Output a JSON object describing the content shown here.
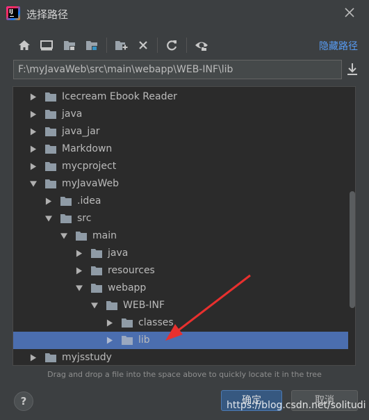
{
  "window": {
    "title": "选择路径",
    "close_glyph": "✕",
    "app_logo_text": "IJ"
  },
  "toolbar": {
    "icons": [
      "home-icon",
      "desktop-icon",
      "project-folder-icon",
      "module-folder-icon",
      "new-folder-icon",
      "delete-icon",
      "refresh-icon",
      "show-hidden-icon"
    ],
    "hide_path_label": "隐藏路径"
  },
  "path_field": {
    "value": "F:\\myJavaWeb\\src\\main\\webapp\\WEB-INF\\lib"
  },
  "tree": {
    "rows": [
      {
        "label": "Icecream Ebook Reader",
        "expanded": false
      },
      {
        "label": "java",
        "expanded": false
      },
      {
        "label": "java_jar",
        "expanded": false
      },
      {
        "label": "Markdown",
        "expanded": false
      },
      {
        "label": "mycproject",
        "expanded": false
      },
      {
        "label": "myJavaWeb",
        "expanded": true
      },
      {
        "label": ".idea",
        "expanded": false
      },
      {
        "label": "src",
        "expanded": true
      },
      {
        "label": "main",
        "expanded": true
      },
      {
        "label": "java",
        "expanded": false
      },
      {
        "label": "resources",
        "expanded": false
      },
      {
        "label": "webapp",
        "expanded": true
      },
      {
        "label": "WEB-INF",
        "expanded": true
      },
      {
        "label": "classes",
        "expanded": false
      },
      {
        "label": "lib",
        "expanded": false,
        "selected": true
      },
      {
        "label": "myjsstudy",
        "expanded": false
      }
    ]
  },
  "hint": "Drag and drop a file into the space above to quickly locate it in the tree",
  "buttons": {
    "help": "?",
    "ok": "确定",
    "cancel": "取消"
  },
  "watermark": "https://blog.csdn.net/solitudi",
  "colors": {
    "background": "#3c3f41",
    "tree_background": "#2b2b2b",
    "selection": "#4b6eaf",
    "link": "#589df6",
    "annotation_arrow": "#e8302e"
  }
}
